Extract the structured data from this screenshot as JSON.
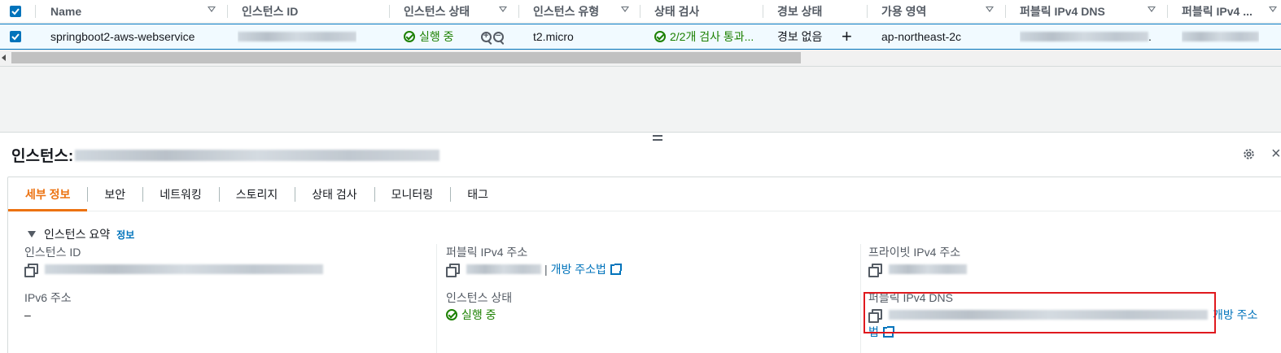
{
  "table": {
    "headers": [
      "Name",
      "인스턴스 ID",
      "인스턴스 상태",
      "인스턴스 유형",
      "상태 검사",
      "경보 상태",
      "가용 영역",
      "퍼블릭 IPv4 DNS",
      "퍼블릭 IPv4 ..."
    ],
    "row": {
      "name": "springboot2-aws-webservice",
      "state": "실행 중",
      "type": "t2.micro",
      "check": "2/2개 검사 통과...",
      "alarm": "경보 없음",
      "zone": "ap-northeast-2c",
      "dns_suffix": "."
    }
  },
  "panel": {
    "title_prefix": "인스턴스:",
    "tabs": [
      "세부 정보",
      "보안",
      "네트워킹",
      "스토리지",
      "상태 검사",
      "모니터링",
      "태그"
    ],
    "summary": {
      "label": "인스턴스 요약",
      "info": "정보"
    },
    "fields": {
      "instance_id_label": "인스턴스 ID",
      "ipv6_label": "IPv6 주소",
      "ipv6_value": "–",
      "public_ip_label": "퍼블릭 IPv4 주소",
      "open_address": "개방 주소법",
      "state_label": "인스턴스 상태",
      "state_value": "실행 중",
      "private_ip_label": "프라이빗 IPv4 주소",
      "public_dns_label": "퍼블릭 IPv4 DNS",
      "open_address_1": "개방 주소",
      "open_address_2": "법"
    }
  },
  "colors": {
    "accent": "#ec7211",
    "link": "#0073bb",
    "success": "#1d8102",
    "highlight": "#e0191e"
  }
}
